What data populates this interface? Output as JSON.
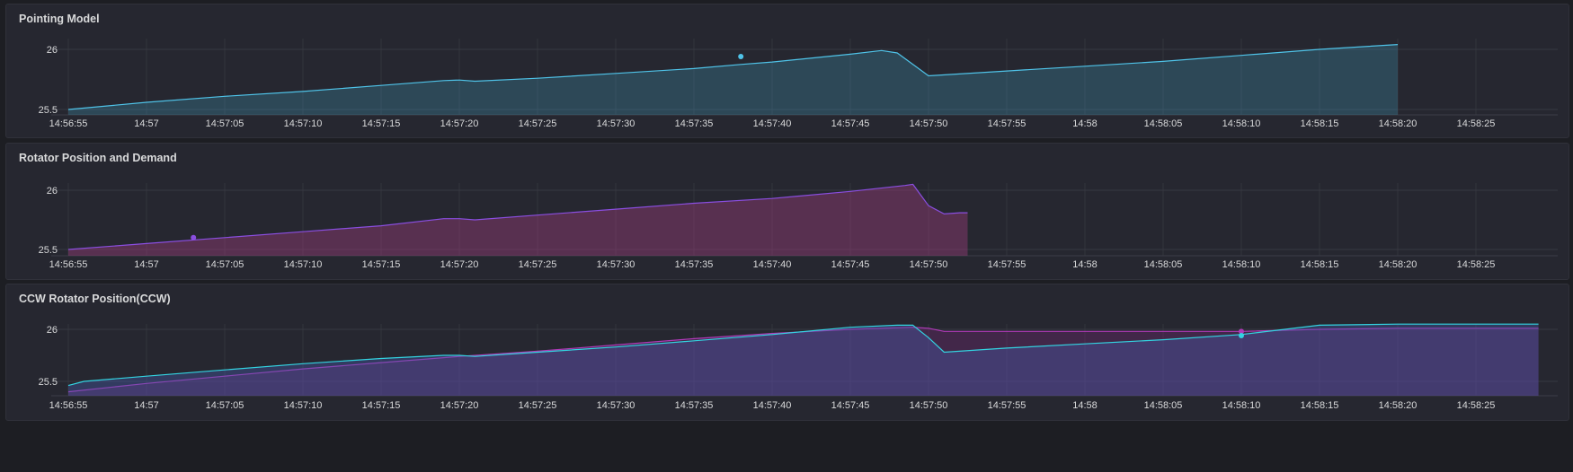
{
  "chart_data": [
    {
      "type": "area",
      "title": "Pointing Model",
      "x_ticks": [
        "14:56:55",
        "14:57",
        "14:57:05",
        "14:57:10",
        "14:57:15",
        "14:57:20",
        "14:57:25",
        "14:57:30",
        "14:57:35",
        "14:57:40",
        "14:57:45",
        "14:57:50",
        "14:57:55",
        "14:58",
        "14:58:05",
        "14:58:10",
        "14:58:15",
        "14:58:20",
        "14:58:25"
      ],
      "y_ticks": [
        "25.5",
        "26"
      ],
      "xlim": [
        0,
        95
      ],
      "ylim": [
        25.45,
        26.1
      ],
      "grid": true,
      "series": [
        {
          "color": "#4fc3e8",
          "fill": "rgba(64,150,180,0.30)",
          "x": [
            0,
            5,
            10,
            15,
            20,
            24,
            25,
            26,
            30,
            35,
            40,
            43,
            45,
            50,
            52,
            53,
            55,
            60,
            65,
            70,
            75,
            80,
            85
          ],
          "y": [
            25.5,
            25.56,
            25.61,
            25.65,
            25.7,
            25.74,
            25.745,
            25.735,
            25.76,
            25.8,
            25.84,
            25.875,
            25.895,
            25.96,
            25.99,
            25.97,
            25.78,
            25.82,
            25.86,
            25.9,
            25.95,
            26.0,
            26.04
          ],
          "markers": [
            {
              "x": 43,
              "y": 25.94
            }
          ]
        }
      ]
    },
    {
      "type": "area",
      "title": "Rotator Position and Demand",
      "x_ticks": [
        "14:56:55",
        "14:57",
        "14:57:05",
        "14:57:10",
        "14:57:15",
        "14:57:20",
        "14:57:25",
        "14:57:30",
        "14:57:35",
        "14:57:40",
        "14:57:45",
        "14:57:50",
        "14:57:55",
        "14:58",
        "14:58:05",
        "14:58:10",
        "14:58:15",
        "14:58:20",
        "14:58:25"
      ],
      "y_ticks": [
        "25.5",
        "26"
      ],
      "xlim": [
        0,
        95
      ],
      "ylim": [
        25.45,
        26.1
      ],
      "grid": true,
      "series": [
        {
          "color": "#8a4ee0",
          "fill": "rgba(150,60,120,0.45)",
          "x": [
            0,
            5,
            10,
            15,
            20,
            24,
            25,
            26,
            30,
            35,
            40,
            45,
            50,
            53.5,
            54,
            55,
            56,
            57,
            57.5
          ],
          "y": [
            25.5,
            25.55,
            25.6,
            25.65,
            25.7,
            25.76,
            25.76,
            25.75,
            25.79,
            25.84,
            25.89,
            25.93,
            25.99,
            26.04,
            26.05,
            25.87,
            25.8,
            25.81,
            25.81
          ],
          "markers": [
            {
              "x": 8,
              "y": 25.6
            }
          ]
        }
      ]
    },
    {
      "type": "area",
      "title": "CCW Rotator Position(CCW)",
      "x_ticks": [
        "14:56:55",
        "14:57",
        "14:57:05",
        "14:57:10",
        "14:57:15",
        "14:57:20",
        "14:57:25",
        "14:57:30",
        "14:57:35",
        "14:57:40",
        "14:57:45",
        "14:57:50",
        "14:57:55",
        "14:58",
        "14:58:05",
        "14:58:10",
        "14:58:15",
        "14:58:20",
        "14:58:25"
      ],
      "y_ticks": [
        "25.5",
        "26"
      ],
      "xlim": [
        0,
        95
      ],
      "ylim": [
        25.45,
        26.1
      ],
      "grid": true,
      "series": [
        {
          "color": "#b03ab8",
          "fill": "rgba(120,40,120,0.35)",
          "x": [
            0,
            5,
            10,
            15,
            20,
            25,
            30,
            35,
            40,
            45,
            50,
            54,
            55,
            56,
            60,
            65,
            70,
            75,
            80,
            85,
            90,
            94
          ],
          "y": [
            25.4,
            25.48,
            25.55,
            25.62,
            25.68,
            25.74,
            25.79,
            25.85,
            25.91,
            25.96,
            26.0,
            26.02,
            26.01,
            25.98,
            25.98,
            25.98,
            25.98,
            25.98,
            26.0,
            26.01,
            26.01,
            26.01
          ],
          "markers": [
            {
              "x": 75,
              "y": 25.98
            }
          ]
        },
        {
          "color": "#33d3e0",
          "fill": "rgba(70,90,170,0.40)",
          "x": [
            0,
            1,
            5,
            10,
            15,
            20,
            24,
            25,
            26,
            30,
            35,
            40,
            45,
            50,
            53,
            54,
            55,
            56,
            60,
            65,
            70,
            75,
            80,
            85,
            90,
            94
          ],
          "y": [
            25.46,
            25.5,
            25.55,
            25.61,
            25.67,
            25.72,
            25.75,
            25.75,
            25.74,
            25.78,
            25.83,
            25.89,
            25.95,
            26.02,
            26.04,
            26.04,
            25.92,
            25.78,
            25.82,
            25.86,
            25.9,
            25.95,
            26.04,
            26.05,
            26.05,
            26.05
          ],
          "markers": [
            {
              "x": 75,
              "y": 25.94
            }
          ]
        }
      ]
    }
  ]
}
